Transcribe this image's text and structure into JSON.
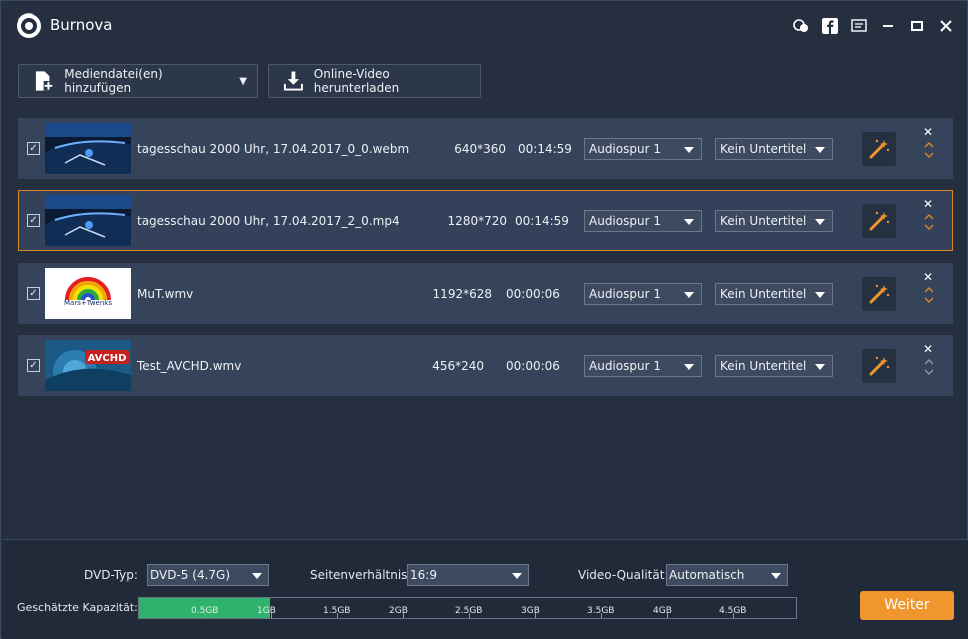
{
  "app": {
    "title": "Burnova"
  },
  "colors": {
    "accent": "#f0962f",
    "capacity_fill": "#2fb36a",
    "selected_border": "#d9892b",
    "background": "#252f40"
  },
  "title_icons": [
    "feedback-icon",
    "facebook-icon",
    "menu-icon",
    "minimize-icon",
    "maximize-icon",
    "close-icon"
  ],
  "toolbar": {
    "add_label": "Mediendatei(en) hinzufügen",
    "download_label": "Online-Video herunterladen"
  },
  "files": [
    {
      "name": "tagesschau 2000 Uhr, 17.04.2017_0_0.webm",
      "resolution": "640*360",
      "duration": "00:14:59",
      "audio": "Audiospur 1",
      "subtitle": "Kein Untertitel",
      "checked": true,
      "selected": false
    },
    {
      "name": "tagesschau 2000 Uhr, 17.04.2017_2_0.mp4",
      "resolution": "1280*720",
      "duration": "00:14:59",
      "audio": "Audiospur 1",
      "subtitle": "Kein Untertitel",
      "checked": true,
      "selected": true
    },
    {
      "name": "MuT.wmv",
      "resolution": "1192*628",
      "duration": "00:00:06",
      "audio": "Audiospur 1",
      "subtitle": "Kein Untertitel",
      "checked": true,
      "selected": false,
      "thumb_text": "Mars+Twenks"
    },
    {
      "name": "Test_AVCHD.wmv",
      "resolution": "456*240",
      "duration": "00:00:06",
      "audio": "Audiospur 1",
      "subtitle": "Kein Untertitel",
      "checked": true,
      "selected": false,
      "thumb_text": "AVCHD"
    }
  ],
  "bottom": {
    "dvd_type_label": "DVD-Typ:",
    "dvd_type_value": "DVD-5 (4.7G)",
    "aspect_label": "Seitenverhältnis:",
    "aspect_value": "16:9",
    "quality_label": "Video-Qualität:",
    "quality_value": "Automatisch",
    "capacity_label": "Geschätzte Kapazität:",
    "capacity_fraction": 0.2,
    "capacity_ticks": [
      "0.5GB",
      "1GB",
      "1.5GB",
      "2GB",
      "2.5GB",
      "3GB",
      "3.5GB",
      "4GB",
      "4.5GB"
    ],
    "next_label": "Weiter"
  }
}
